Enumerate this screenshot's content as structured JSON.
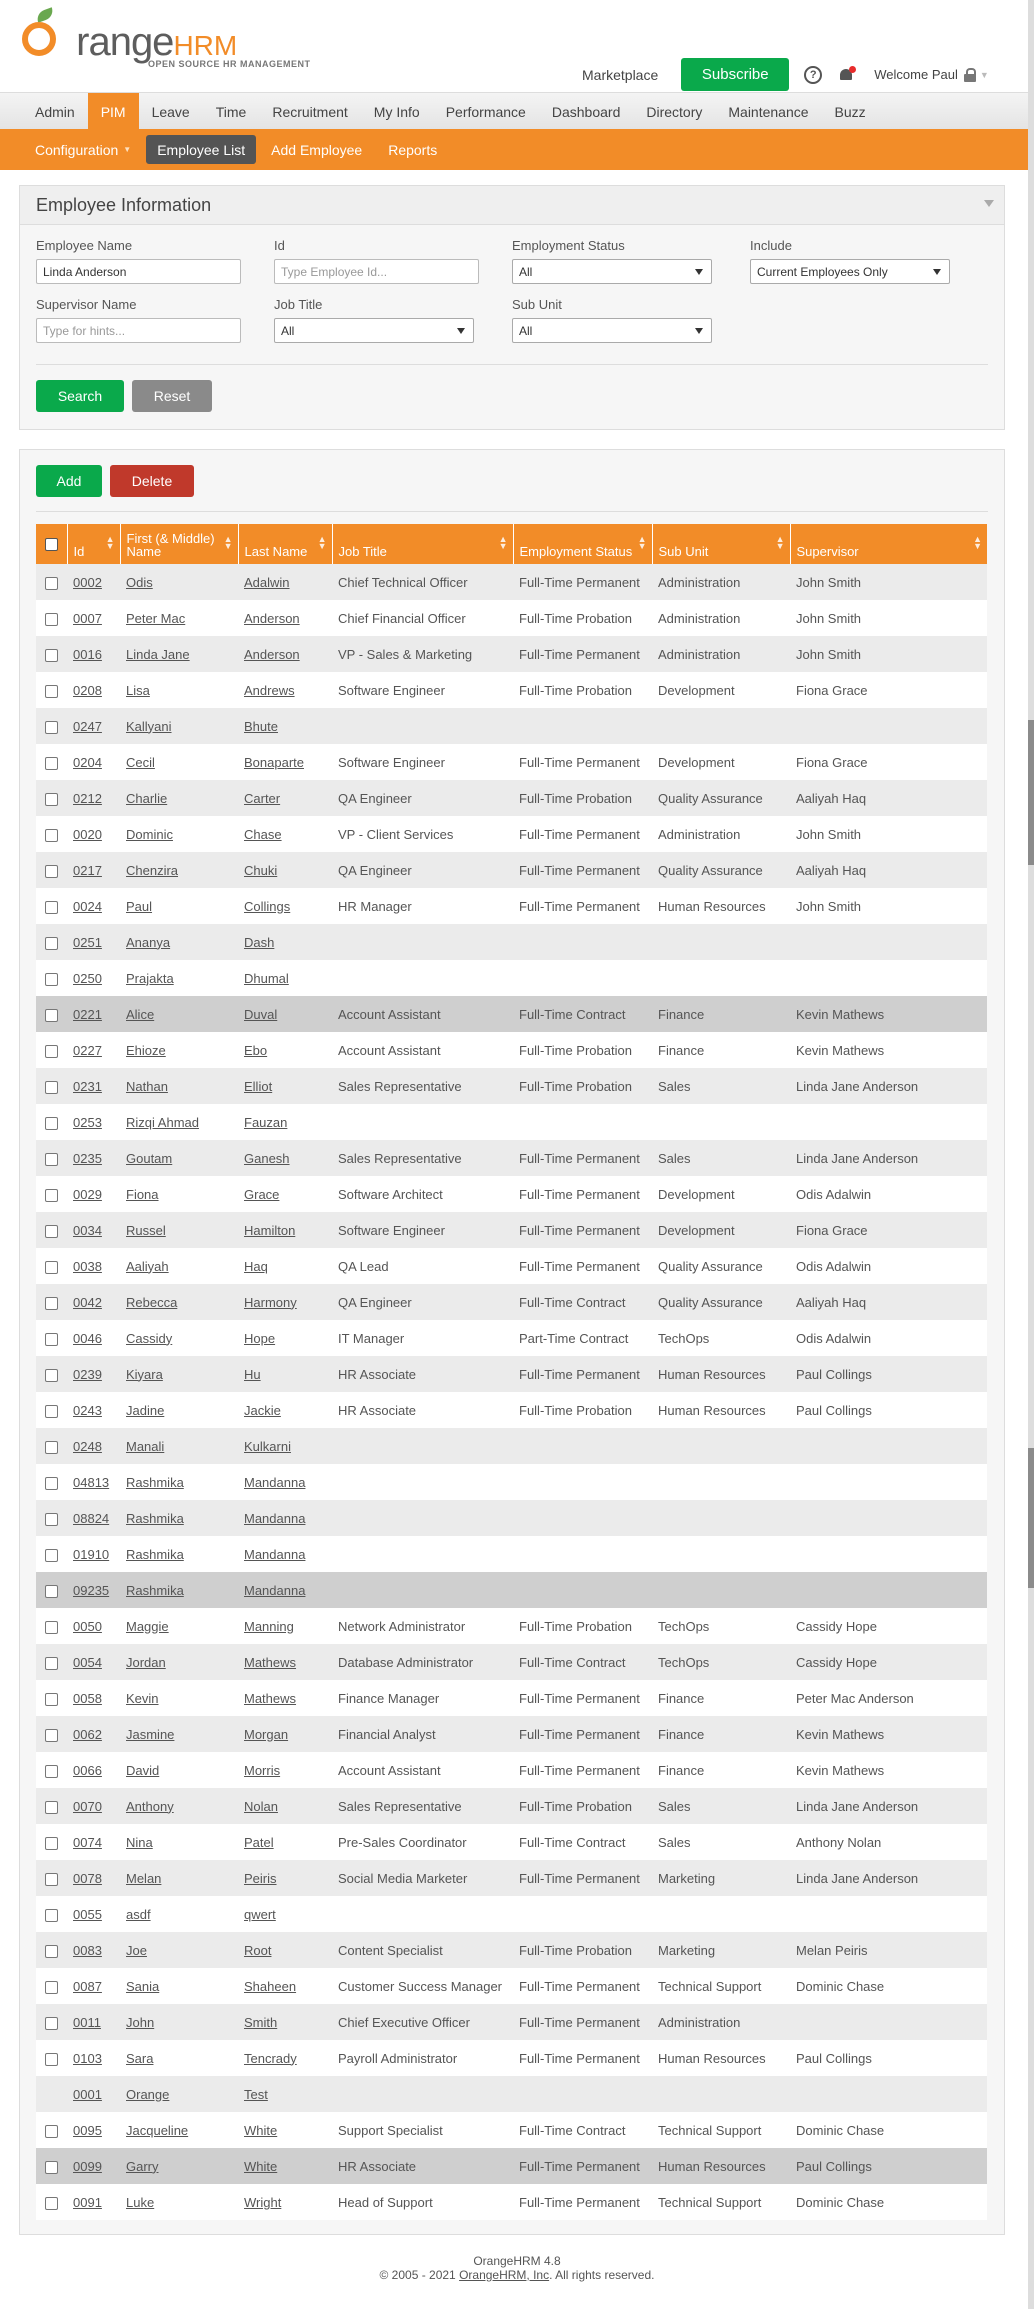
{
  "header": {
    "logo_text": "OrangeHRM",
    "logo_tagline": "OPEN SOURCE HR MANAGEMENT",
    "marketplace_label": "Marketplace",
    "subscribe_label": "Subscribe",
    "help_glyph": "?",
    "welcome_text": "Welcome Paul"
  },
  "main_menu": [
    "Admin",
    "PIM",
    "Leave",
    "Time",
    "Recruitment",
    "My Info",
    "Performance",
    "Dashboard",
    "Directory",
    "Maintenance",
    "Buzz"
  ],
  "main_menu_active": "PIM",
  "sub_menu": [
    "Configuration",
    "Employee List",
    "Add Employee",
    "Reports"
  ],
  "sub_menu_active": "Employee List",
  "search": {
    "title": "Employee Information",
    "employee_name_label": "Employee Name",
    "employee_name_value": "Linda Anderson",
    "id_label": "Id",
    "id_placeholder": "Type Employee Id...",
    "employment_status_label": "Employment Status",
    "employment_status_value": "All",
    "include_label": "Include",
    "include_value": "Current Employees Only",
    "supervisor_label": "Supervisor Name",
    "supervisor_placeholder": "Type for hints...",
    "job_title_label": "Job Title",
    "job_title_value": "All",
    "sub_unit_label": "Sub Unit",
    "sub_unit_value": "All",
    "search_button": "Search",
    "reset_button": "Reset"
  },
  "list": {
    "add_button": "Add",
    "delete_button": "Delete",
    "columns": [
      "Id",
      "First (& Middle) Name",
      "Last Name",
      "Job Title",
      "Employment Status",
      "Sub Unit",
      "Supervisor"
    ],
    "rows": [
      {
        "id": "0002",
        "first": "Odis",
        "last": "Adalwin",
        "job": "Chief Technical Officer",
        "status": "Full-Time Permanent",
        "unit": "Administration",
        "supervisor": "John Smith",
        "checkbox": true,
        "highlight": false
      },
      {
        "id": "0007",
        "first": "Peter Mac",
        "last": "Anderson",
        "job": "Chief Financial Officer",
        "status": "Full-Time Probation",
        "unit": "Administration",
        "supervisor": "John Smith",
        "checkbox": true,
        "highlight": false
      },
      {
        "id": "0016",
        "first": "Linda Jane",
        "last": "Anderson",
        "job": "VP - Sales & Marketing",
        "status": "Full-Time Permanent",
        "unit": "Administration",
        "supervisor": "John Smith",
        "checkbox": true,
        "highlight": false
      },
      {
        "id": "0208",
        "first": "Lisa",
        "last": "Andrews",
        "job": "Software Engineer",
        "status": "Full-Time Probation",
        "unit": "Development",
        "supervisor": "Fiona Grace",
        "checkbox": true,
        "highlight": false
      },
      {
        "id": "0247",
        "first": "Kallyani",
        "last": "Bhute",
        "job": "",
        "status": "",
        "unit": "",
        "supervisor": "",
        "checkbox": true,
        "highlight": false
      },
      {
        "id": "0204",
        "first": "Cecil",
        "last": "Bonaparte",
        "job": "Software Engineer",
        "status": "Full-Time Permanent",
        "unit": "Development",
        "supervisor": "Fiona Grace",
        "checkbox": true,
        "highlight": false
      },
      {
        "id": "0212",
        "first": "Charlie",
        "last": "Carter",
        "job": "QA Engineer",
        "status": "Full-Time Probation",
        "unit": "Quality Assurance",
        "supervisor": "Aaliyah Haq",
        "checkbox": true,
        "highlight": false
      },
      {
        "id": "0020",
        "first": "Dominic",
        "last": "Chase",
        "job": "VP - Client Services",
        "status": "Full-Time Permanent",
        "unit": "Administration",
        "supervisor": "John Smith",
        "checkbox": true,
        "highlight": false
      },
      {
        "id": "0217",
        "first": "Chenzira",
        "last": "Chuki",
        "job": "QA Engineer",
        "status": "Full-Time Permanent",
        "unit": "Quality Assurance",
        "supervisor": "Aaliyah Haq",
        "checkbox": true,
        "highlight": false
      },
      {
        "id": "0024",
        "first": "Paul",
        "last": "Collings",
        "job": "HR Manager",
        "status": "Full-Time Permanent",
        "unit": "Human Resources",
        "supervisor": "John Smith",
        "checkbox": true,
        "highlight": false
      },
      {
        "id": "0251",
        "first": "Ananya",
        "last": "Dash",
        "job": "",
        "status": "",
        "unit": "",
        "supervisor": "",
        "checkbox": true,
        "highlight": false
      },
      {
        "id": "0250",
        "first": "Prajakta",
        "last": "Dhumal",
        "job": "",
        "status": "",
        "unit": "",
        "supervisor": "",
        "checkbox": true,
        "highlight": false
      },
      {
        "id": "0221",
        "first": "Alice",
        "last": "Duval",
        "job": "Account Assistant",
        "status": "Full-Time Contract",
        "unit": "Finance",
        "supervisor": "Kevin Mathews",
        "checkbox": true,
        "highlight": true
      },
      {
        "id": "0227",
        "first": "Ehioze",
        "last": "Ebo",
        "job": "Account Assistant",
        "status": "Full-Time Probation",
        "unit": "Finance",
        "supervisor": "Kevin Mathews",
        "checkbox": true,
        "highlight": false
      },
      {
        "id": "0231",
        "first": "Nathan",
        "last": "Elliot",
        "job": "Sales Representative",
        "status": "Full-Time Probation",
        "unit": "Sales",
        "supervisor": "Linda Jane Anderson",
        "checkbox": true,
        "highlight": false
      },
      {
        "id": "0253",
        "first": "Rizqi Ahmad",
        "last": "Fauzan",
        "job": "",
        "status": "",
        "unit": "",
        "supervisor": "",
        "checkbox": true,
        "highlight": false
      },
      {
        "id": "0235",
        "first": "Goutam",
        "last": "Ganesh",
        "job": "Sales Representative",
        "status": "Full-Time Permanent",
        "unit": "Sales",
        "supervisor": "Linda Jane Anderson",
        "checkbox": true,
        "highlight": false
      },
      {
        "id": "0029",
        "first": "Fiona",
        "last": "Grace",
        "job": "Software Architect",
        "status": "Full-Time Permanent",
        "unit": "Development",
        "supervisor": "Odis Adalwin",
        "checkbox": true,
        "highlight": false
      },
      {
        "id": "0034",
        "first": "Russel",
        "last": "Hamilton",
        "job": "Software Engineer",
        "status": "Full-Time Permanent",
        "unit": "Development",
        "supervisor": "Fiona Grace",
        "checkbox": true,
        "highlight": false
      },
      {
        "id": "0038",
        "first": "Aaliyah",
        "last": "Haq",
        "job": "QA Lead",
        "status": "Full-Time Permanent",
        "unit": "Quality Assurance",
        "supervisor": "Odis Adalwin",
        "checkbox": true,
        "highlight": false
      },
      {
        "id": "0042",
        "first": "Rebecca",
        "last": "Harmony",
        "job": "QA Engineer",
        "status": "Full-Time Contract",
        "unit": "Quality Assurance",
        "supervisor": "Aaliyah Haq",
        "checkbox": true,
        "highlight": false
      },
      {
        "id": "0046",
        "first": "Cassidy",
        "last": "Hope",
        "job": "IT Manager",
        "status": "Part-Time Contract",
        "unit": "TechOps",
        "supervisor": "Odis Adalwin",
        "checkbox": true,
        "highlight": false
      },
      {
        "id": "0239",
        "first": "Kiyara",
        "last": "Hu",
        "job": "HR Associate",
        "status": "Full-Time Permanent",
        "unit": "Human Resources",
        "supervisor": "Paul Collings",
        "checkbox": true,
        "highlight": false
      },
      {
        "id": "0243",
        "first": "Jadine",
        "last": "Jackie",
        "job": "HR Associate",
        "status": "Full-Time Probation",
        "unit": "Human Resources",
        "supervisor": "Paul Collings",
        "checkbox": true,
        "highlight": false
      },
      {
        "id": "0248",
        "first": "Manali",
        "last": "Kulkarni",
        "job": "",
        "status": "",
        "unit": "",
        "supervisor": "",
        "checkbox": true,
        "highlight": false
      },
      {
        "id": "04813",
        "first": "Rashmika",
        "last": "Mandanna",
        "job": "",
        "status": "",
        "unit": "",
        "supervisor": "",
        "checkbox": true,
        "highlight": false
      },
      {
        "id": "08824",
        "first": "Rashmika",
        "last": "Mandanna",
        "job": "",
        "status": "",
        "unit": "",
        "supervisor": "",
        "checkbox": true,
        "highlight": false
      },
      {
        "id": "01910",
        "first": "Rashmika",
        "last": "Mandanna",
        "job": "",
        "status": "",
        "unit": "",
        "supervisor": "",
        "checkbox": true,
        "highlight": false
      },
      {
        "id": "09235",
        "first": "Rashmika",
        "last": "Mandanna",
        "job": "",
        "status": "",
        "unit": "",
        "supervisor": "",
        "checkbox": true,
        "highlight": true
      },
      {
        "id": "0050",
        "first": "Maggie",
        "last": "Manning",
        "job": "Network Administrator",
        "status": "Full-Time Probation",
        "unit": "TechOps",
        "supervisor": "Cassidy Hope",
        "checkbox": true,
        "highlight": false
      },
      {
        "id": "0054",
        "first": "Jordan",
        "last": "Mathews",
        "job": "Database Administrator",
        "status": "Full-Time Contract",
        "unit": "TechOps",
        "supervisor": "Cassidy Hope",
        "checkbox": true,
        "highlight": false
      },
      {
        "id": "0058",
        "first": "Kevin",
        "last": "Mathews",
        "job": "Finance Manager",
        "status": "Full-Time Permanent",
        "unit": "Finance",
        "supervisor": "Peter Mac Anderson",
        "checkbox": true,
        "highlight": false
      },
      {
        "id": "0062",
        "first": "Jasmine",
        "last": "Morgan",
        "job": "Financial Analyst",
        "status": "Full-Time Permanent",
        "unit": "Finance",
        "supervisor": "Kevin Mathews",
        "checkbox": true,
        "highlight": false
      },
      {
        "id": "0066",
        "first": "David",
        "last": "Morris",
        "job": "Account Assistant",
        "status": "Full-Time Permanent",
        "unit": "Finance",
        "supervisor": "Kevin Mathews",
        "checkbox": true,
        "highlight": false
      },
      {
        "id": "0070",
        "first": "Anthony",
        "last": "Nolan",
        "job": "Sales Representative",
        "status": "Full-Time Probation",
        "unit": "Sales",
        "supervisor": "Linda Jane Anderson",
        "checkbox": true,
        "highlight": false
      },
      {
        "id": "0074",
        "first": "Nina",
        "last": "Patel",
        "job": "Pre-Sales Coordinator",
        "status": "Full-Time Contract",
        "unit": "Sales",
        "supervisor": "Anthony Nolan",
        "checkbox": true,
        "highlight": false
      },
      {
        "id": "0078",
        "first": "Melan",
        "last": "Peiris",
        "job": "Social Media Marketer",
        "status": "Full-Time Permanent",
        "unit": "Marketing",
        "supervisor": "Linda Jane Anderson",
        "checkbox": true,
        "highlight": false
      },
      {
        "id": "0055",
        "first": "asdf",
        "last": "qwert",
        "job": "",
        "status": "",
        "unit": "",
        "supervisor": "",
        "checkbox": true,
        "highlight": false
      },
      {
        "id": "0083",
        "first": "Joe",
        "last": "Root",
        "job": "Content Specialist",
        "status": "Full-Time Probation",
        "unit": "Marketing",
        "supervisor": "Melan Peiris",
        "checkbox": true,
        "highlight": false
      },
      {
        "id": "0087",
        "first": "Sania",
        "last": "Shaheen",
        "job": "Customer Success Manager",
        "status": "Full-Time Permanent",
        "unit": "Technical Support",
        "supervisor": "Dominic Chase",
        "checkbox": true,
        "highlight": false
      },
      {
        "id": "0011",
        "first": "John",
        "last": "Smith",
        "job": "Chief Executive Officer",
        "status": "Full-Time Permanent",
        "unit": "Administration",
        "supervisor": "",
        "checkbox": true,
        "highlight": false
      },
      {
        "id": "0103",
        "first": "Sara",
        "last": "Tencrady",
        "job": "Payroll Administrator",
        "status": "Full-Time Permanent",
        "unit": "Human Resources",
        "supervisor": "Paul Collings",
        "checkbox": true,
        "highlight": false
      },
      {
        "id": "0001",
        "first": "Orange",
        "last": "Test",
        "job": "",
        "status": "",
        "unit": "",
        "supervisor": "",
        "checkbox": false,
        "highlight": false
      },
      {
        "id": "0095",
        "first": "Jacqueline",
        "last": "White",
        "job": "Support Specialist",
        "status": "Full-Time Contract",
        "unit": "Technical Support",
        "supervisor": "Dominic Chase",
        "checkbox": true,
        "highlight": false
      },
      {
        "id": "0099",
        "first": "Garry",
        "last": "White",
        "job": "HR Associate",
        "status": "Full-Time Permanent",
        "unit": "Human Resources",
        "supervisor": "Paul Collings",
        "checkbox": true,
        "highlight": true
      },
      {
        "id": "0091",
        "first": "Luke",
        "last": "Wright",
        "job": "Head of Support",
        "status": "Full-Time Permanent",
        "unit": "Technical Support",
        "supervisor": "Dominic Chase",
        "checkbox": true,
        "highlight": false
      }
    ]
  },
  "footer": {
    "version": "OrangeHRM 4.8",
    "copyright_prefix": "© 2005 - 2021",
    "copyright_link": "OrangeHRM, Inc",
    "copyright_suffix": ". All rights reserved."
  },
  "colors": {
    "brand_orange": "#f28c28",
    "button_green": "#0aa94b",
    "button_red": "#c0392b",
    "submenu_active": "#545454"
  }
}
